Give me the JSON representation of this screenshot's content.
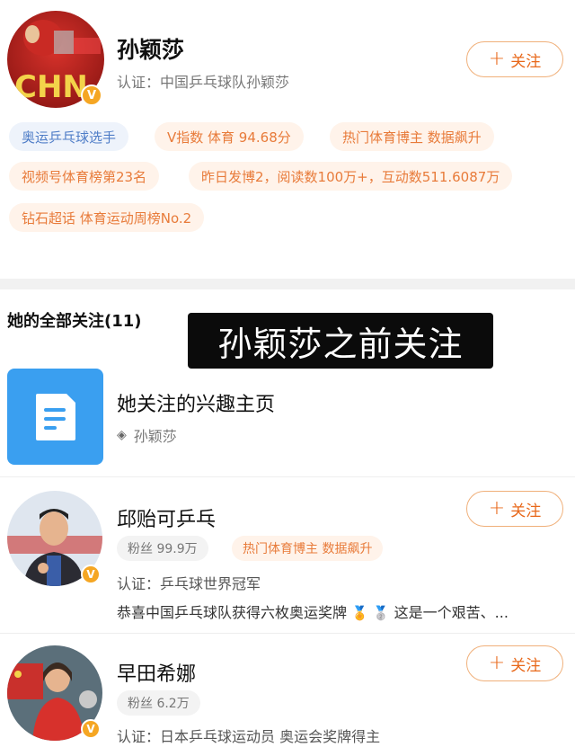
{
  "profile": {
    "name": "孙颖莎",
    "verify": "认证：中国乒乓球队孙颖莎",
    "badge": "V",
    "avatar_text": "CHN",
    "follow_label": "关注",
    "tags": [
      {
        "text": "奥运乒乓球选手",
        "style": "blue"
      },
      {
        "text": "V指数 体育 94.68分",
        "style": "orange"
      },
      {
        "text": "热门体育博主 数据飙升",
        "style": "orange"
      },
      {
        "text": "视频号体育榜第23名",
        "style": "orange"
      },
      {
        "text": "昨日发博2，阅读数100万+，互动数511.6087万",
        "style": "orange"
      },
      {
        "text": "钻石超话 体育运动周榜No.2",
        "style": "orange"
      }
    ]
  },
  "following": {
    "title": "她的全部关注(11)",
    "overlay_caption": "孙颖莎之前关注",
    "interest": {
      "title": "她关注的兴趣主页",
      "subtitle": "孙颖莎",
      "icon": "document-icon"
    },
    "users": [
      {
        "name": "邱贻可乒乓",
        "fans": "粉丝 99.9万",
        "hot_tag": "热门体育博主 数据飙升",
        "verify": "认证：乒乓球世界冠军",
        "desc": "恭喜中国乒乓球队获得六枚奥运奖牌",
        "desc_tail": "这是一个艰苦、...",
        "follow_label": "关注",
        "badge": "V"
      },
      {
        "name": "早田希娜",
        "fans": "粉丝 6.2万",
        "verify": "认证：日本乒乓球运动员 奥运会奖牌得主",
        "follow_label": "关注",
        "badge": "V"
      }
    ]
  },
  "colors": {
    "accent": "#e8681a",
    "badge": "#f5a623",
    "interest_icon_bg": "#3a9ff0",
    "tag_blue_text": "#4f7dc7",
    "tag_orange_text": "#e87b3a"
  }
}
